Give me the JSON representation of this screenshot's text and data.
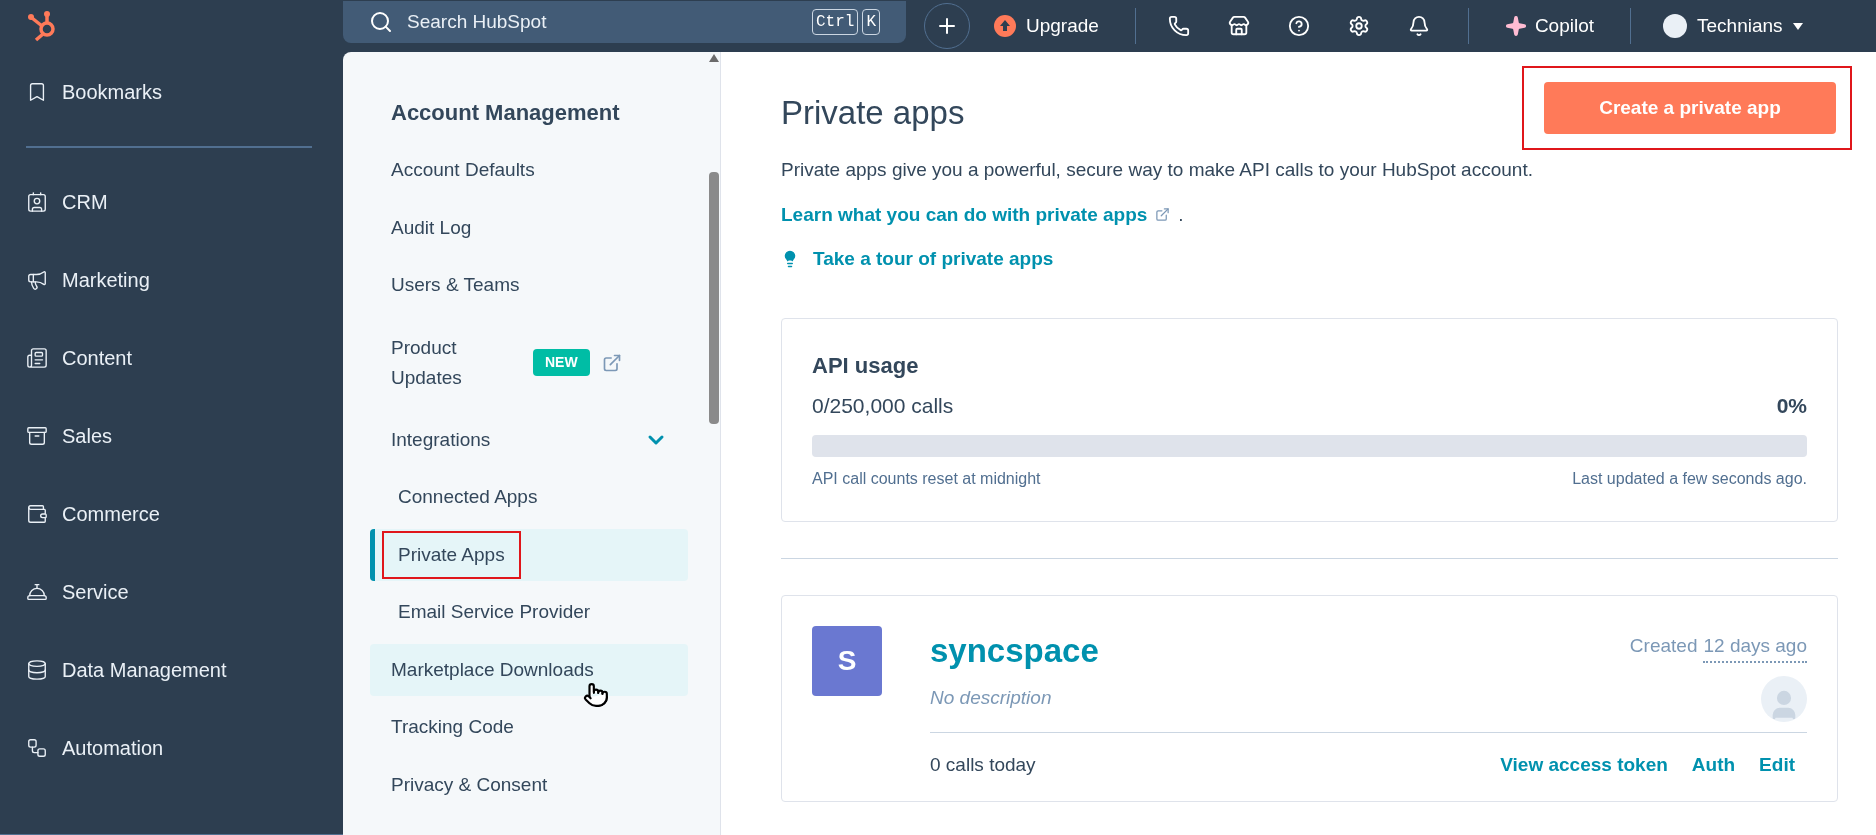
{
  "topbar": {
    "search": {
      "placeholder": "Search HubSpot",
      "keys": [
        "Ctrl",
        "K"
      ]
    },
    "upgrade": "Upgrade",
    "copilot": "Copilot",
    "account": "Technians"
  },
  "sidebar": {
    "items": [
      {
        "label": "Bookmarks",
        "kind": "bookmarks"
      },
      {
        "label": "CRM",
        "kind": "crm"
      },
      {
        "label": "Marketing",
        "kind": "marketing"
      },
      {
        "label": "Content",
        "kind": "content"
      },
      {
        "label": "Sales",
        "kind": "sales"
      },
      {
        "label": "Commerce",
        "kind": "commerce"
      },
      {
        "label": "Service",
        "kind": "service"
      },
      {
        "label": "Data Management",
        "kind": "data"
      },
      {
        "label": "Automation",
        "kind": "automation"
      }
    ]
  },
  "settings_nav": {
    "heading": "Account Management",
    "items": [
      {
        "label": "Account Defaults",
        "selected": false,
        "hovered": false,
        "highlighted": false
      },
      {
        "label": "Audit Log",
        "selected": false,
        "hovered": false,
        "highlighted": false
      },
      {
        "label": "Users & Teams",
        "selected": false,
        "hovered": false,
        "highlighted": false
      },
      {
        "label": "Product Updates",
        "selected": false,
        "hovered": false,
        "highlighted": false,
        "badge": "NEW",
        "external": true
      },
      {
        "label": "Integrations",
        "selected": false,
        "hovered": false,
        "highlighted": false,
        "expanded": true,
        "children": [
          {
            "label": "Connected Apps",
            "selected": false,
            "hovered": false,
            "highlighted": false
          },
          {
            "label": "Private Apps",
            "selected": true,
            "hovered": false,
            "highlighted": true
          },
          {
            "label": "Email Service Provider",
            "selected": false,
            "hovered": false,
            "highlighted": false
          }
        ]
      },
      {
        "label": "Marketplace Downloads",
        "selected": false,
        "hovered": true,
        "highlighted": false
      },
      {
        "label": "Tracking Code",
        "selected": false,
        "hovered": false,
        "highlighted": false
      },
      {
        "label": "Privacy & Consent",
        "selected": false,
        "hovered": false,
        "highlighted": false
      }
    ]
  },
  "main": {
    "title": "Private apps",
    "create_button": {
      "label": "Create a private app",
      "highlighted": true
    },
    "description": "Private apps give you a powerful, secure way to make API calls to your HubSpot account.",
    "learn_link": "Learn what you can do with private apps",
    "learn_suffix": ".",
    "tour_link": "Take a tour of private apps",
    "api_usage": {
      "title": "API usage",
      "calls": "0/250,000 calls",
      "percent": "0%",
      "level": 0,
      "reset_note": "API call counts reset at midnight",
      "updated_note": "Last updated a few seconds ago."
    },
    "apps": [
      {
        "initial": "S",
        "name": "syncspace",
        "created_label": "Created",
        "created_ago": "12 days ago",
        "description": "No description",
        "calls_today": "0 calls today",
        "actions": [
          "View access token",
          "Auth",
          "Edit"
        ]
      }
    ]
  }
}
